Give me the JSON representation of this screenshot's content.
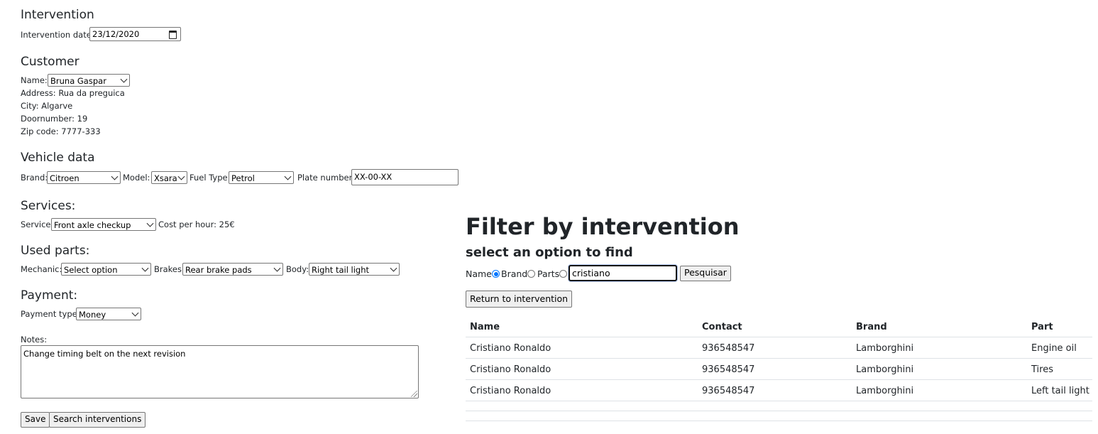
{
  "intervention": {
    "heading": "Intervention",
    "date_label": "Intervention date:",
    "date_value": "23/12/2020"
  },
  "customer": {
    "heading": "Customer",
    "name_label": "Name:",
    "name_value": "Bruna Gaspar",
    "address": "Address: Rua da preguica",
    "city": "City: Algarve",
    "doornumber": "Doornumber: 19",
    "zip": "Zip code: 7777-333"
  },
  "vehicle": {
    "heading": "Vehicle data",
    "brand_label": "Brand:",
    "brand_value": "Citroen",
    "model_label": "Model:",
    "model_value": "Xsara",
    "fuel_label": "Fuel Type:",
    "fuel_value": "Petrol",
    "plate_label": "Plate number:",
    "plate_value": "XX-00-XX"
  },
  "services": {
    "heading": "Services:",
    "service_label": "Service:",
    "service_value": "Front axle checkup",
    "cost": "Cost per hour: 25€"
  },
  "parts": {
    "heading": "Used parts:",
    "mechanic_label": "Mechanic:",
    "mechanic_value": "Select option",
    "brakes_label": "Brakes:",
    "brakes_value": "Rear brake pads",
    "body_label": "Body:",
    "body_value": "Right tail light"
  },
  "payment": {
    "heading": "Payment:",
    "type_label": "Payment type:",
    "type_value": "Money"
  },
  "notes": {
    "label": "Notes:",
    "value": "Change timing belt on the next revision"
  },
  "actions": {
    "save": "Save",
    "search": "Search interventions"
  },
  "filter": {
    "title": "Filter by intervention",
    "subtitle": "select an option to find",
    "opt_name": "Name",
    "opt_brand": "Brand",
    "opt_parts": "Parts",
    "query": "cristiano",
    "search_btn": "Pesquisar",
    "return_btn": "Return to intervention"
  },
  "table": {
    "headers": [
      "Name",
      "Contact",
      "Brand",
      "Part"
    ],
    "rows": [
      [
        "Cristiano Ronaldo",
        "936548547",
        "Lamborghini",
        "Engine oil"
      ],
      [
        "Cristiano Ronaldo",
        "936548547",
        "Lamborghini",
        "Tires"
      ],
      [
        "Cristiano Ronaldo",
        "936548547",
        "Lamborghini",
        "Left tail light"
      ]
    ]
  }
}
